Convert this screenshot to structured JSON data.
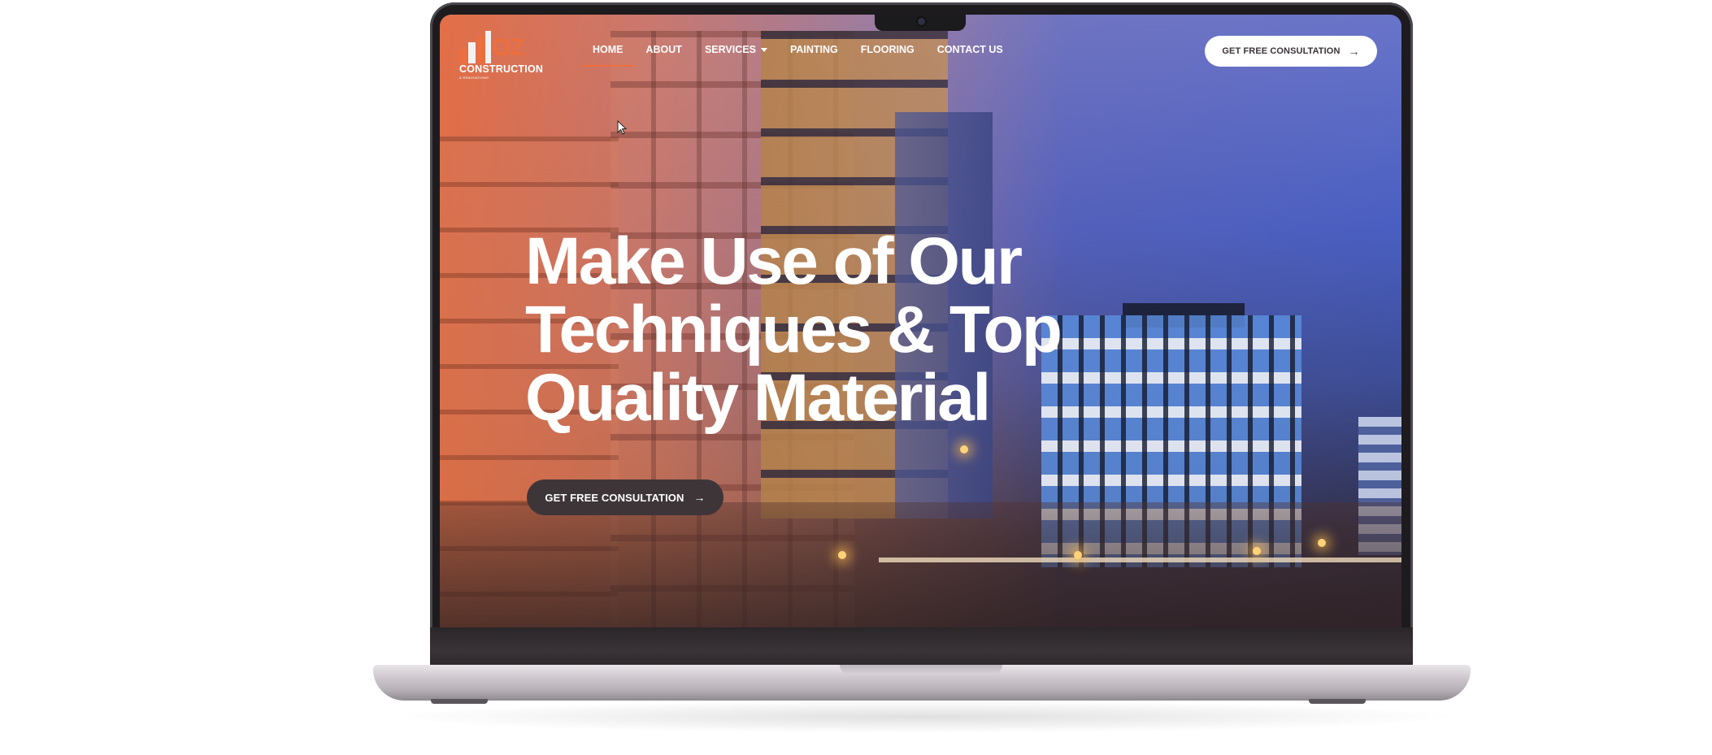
{
  "header": {
    "logo": {
      "mark": "OZ",
      "name": "CONSTRUCTION",
      "tagline": "& RENOVATIONS"
    },
    "nav": [
      {
        "label": "HOME",
        "active": true,
        "dropdown": false
      },
      {
        "label": "ABOUT",
        "active": false,
        "dropdown": false
      },
      {
        "label": "SERVICES",
        "active": false,
        "dropdown": true
      },
      {
        "label": "PAINTING",
        "active": false,
        "dropdown": false
      },
      {
        "label": "FLOORING",
        "active": false,
        "dropdown": false
      },
      {
        "label": "CONTACT US",
        "active": false,
        "dropdown": false
      }
    ],
    "cta_label": "GET FREE CONSULTATION",
    "cta_icon": "arrow-right-icon"
  },
  "hero": {
    "title_lines": [
      "Make Use of Our",
      "Techniques & Top",
      "Quality Material"
    ],
    "cta_label": "GET FREE CONSULTATION",
    "cta_icon": "arrow-right-icon"
  },
  "colors": {
    "accent": "#ec6f3d",
    "dark_button": "#3e3539",
    "white": "#ffffff"
  }
}
